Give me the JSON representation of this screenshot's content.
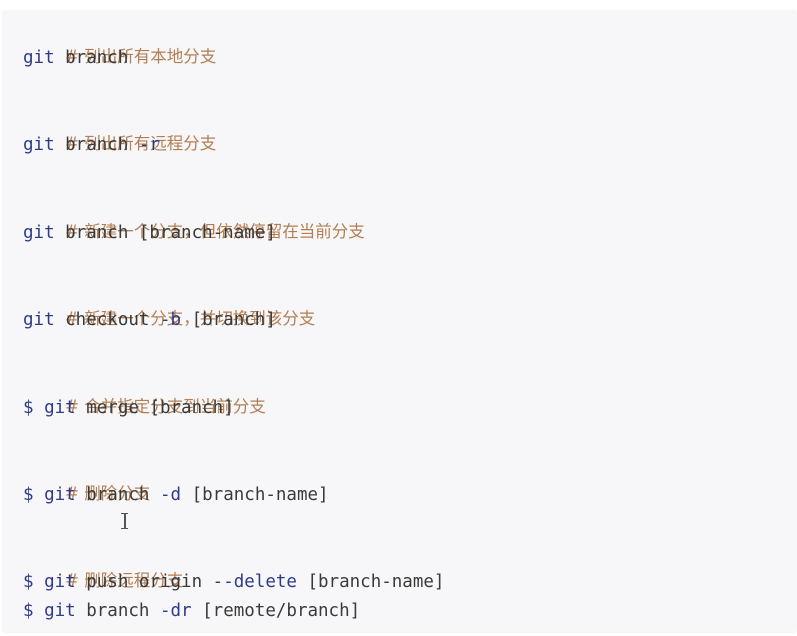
{
  "code_block": {
    "lines": [
      {
        "type": "comment",
        "text": "# 列出所有本地分支"
      },
      {
        "type": "command",
        "prefix": "",
        "cmd": "git",
        "rest_plain": " branch",
        "flag": "",
        "arg": ""
      },
      {
        "type": "comment",
        "text": "# 列出所有远程分支"
      },
      {
        "type": "command",
        "prefix": "",
        "cmd": "git",
        "rest_plain": " branch ",
        "flag": "-r",
        "arg": ""
      },
      {
        "type": "comment",
        "text": "# 新建一个分支，但依然停留在当前分支"
      },
      {
        "type": "command",
        "prefix": "",
        "cmd": "git",
        "rest_plain": " branch [branch-name]",
        "flag": "",
        "arg": ""
      },
      {
        "type": "comment",
        "text": "# 新建一个分支，并切换到该分支"
      },
      {
        "type": "command",
        "prefix": "",
        "cmd": "git",
        "rest_plain": " checkout ",
        "flag": "-b",
        "arg": " [branch]"
      },
      {
        "type": "comment",
        "text": "# 合并指定分支到当前分支"
      },
      {
        "type": "command",
        "prefix": "$ ",
        "cmd": "git",
        "rest_plain": " merge [branch]",
        "flag": "",
        "arg": ""
      },
      {
        "type": "comment",
        "text": "# 删除分支"
      },
      {
        "type": "command",
        "prefix": "$ ",
        "cmd": "git",
        "rest_plain": " branch ",
        "flag": "-d",
        "arg": " [branch-name]"
      },
      {
        "type": "comment",
        "text": "# 删除远程分支"
      },
      {
        "type": "command",
        "prefix": "$ ",
        "cmd": "git",
        "rest_plain": " push origin ",
        "flag": "--delete",
        "arg": " [branch-name]"
      },
      {
        "type": "command",
        "prefix": "$ ",
        "cmd": "git",
        "rest_plain": " branch ",
        "flag": "-dr",
        "arg": " [remote/branch]"
      }
    ]
  },
  "cursor": {
    "icon": "text-cursor-icon"
  }
}
